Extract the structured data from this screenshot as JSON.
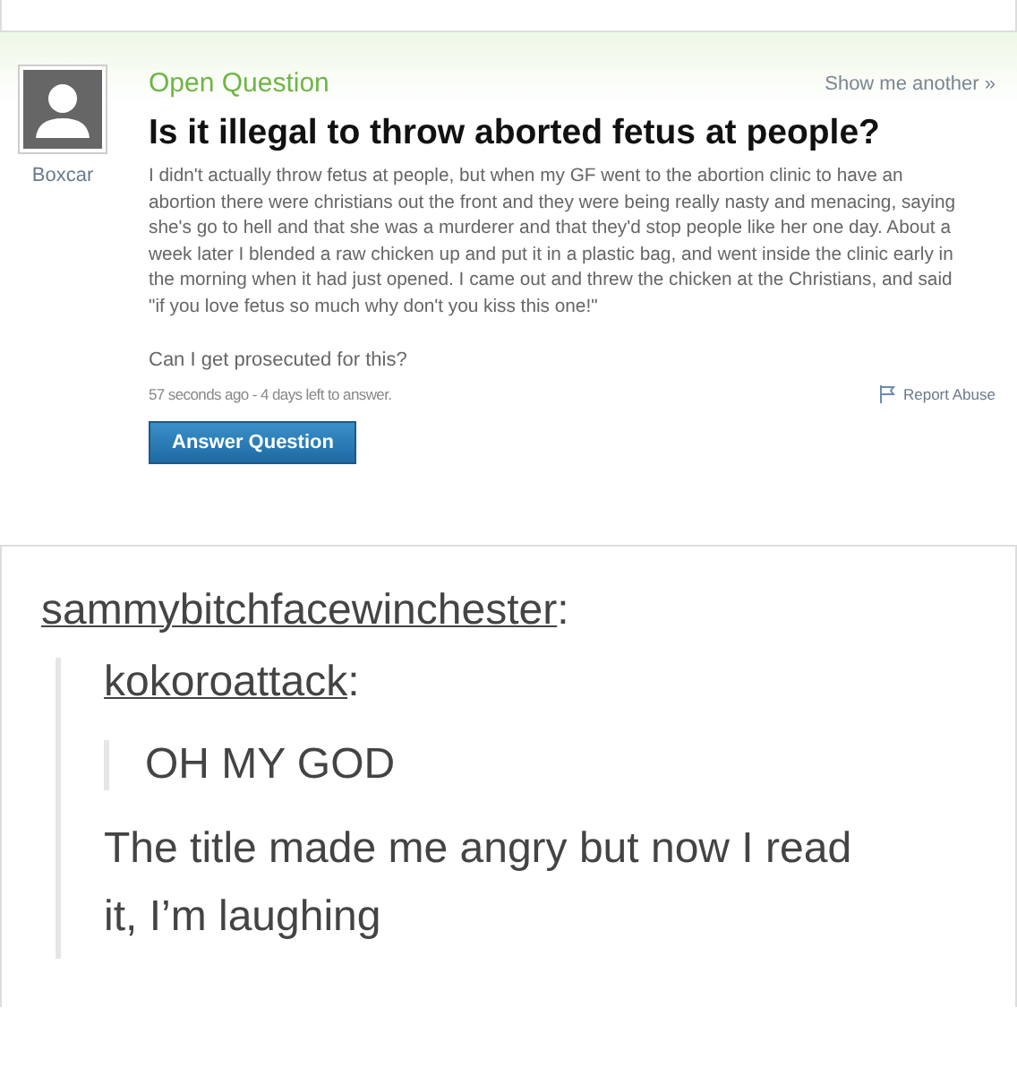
{
  "question": {
    "status": "Open Question",
    "show_another": "Show me another »",
    "asker": "Boxcar",
    "title": "Is it illegal to throw aborted fetus at people?",
    "body": "I didn't actually throw fetus at people, but when my GF went to the abortion clinic to have an abortion there were christians out the front and they were being really nasty and menacing, saying she's go to hell and that she was a murderer and that they'd stop people like her one day. About a week later I blended a raw chicken up and put it in a plastic bag, and went inside the clinic early in the morning when it had just opened. I came out and threw the chicken at the Christians, and said \"if you love fetus so much why don't you kiss this one!\"",
    "follow_up": "Can I get prosecuted for this?",
    "meta": "57 seconds ago - 4 days left to answer.",
    "report": "Report Abuse",
    "answer_button": "Answer Question"
  },
  "post": {
    "reblogger": "sammybitchfacewinchester",
    "colon": ":",
    "reply": {
      "author": "kokoroattack",
      "colon": ":",
      "quote": "OH MY GOD",
      "text": "The title made me angry but now I read it, I’m laughing"
    }
  }
}
